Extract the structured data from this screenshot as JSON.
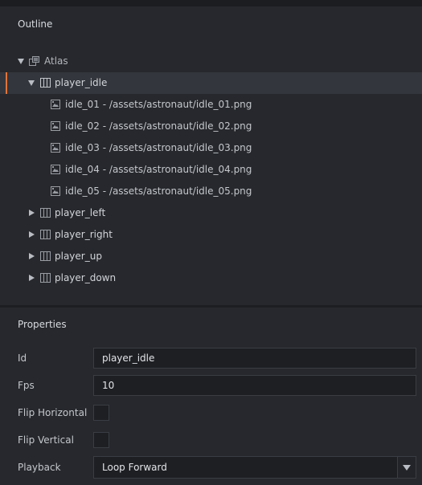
{
  "outline": {
    "title": "Outline",
    "root": {
      "label": "Atlas",
      "icon": "atlas-icon",
      "expanded": true
    },
    "animations": [
      {
        "label": "player_idle",
        "icon": "animation-icon",
        "expanded": true,
        "selected": true,
        "images": [
          {
            "label": "idle_01 - /assets/astronaut/idle_01.png",
            "icon": "image-icon"
          },
          {
            "label": "idle_02 - /assets/astronaut/idle_02.png",
            "icon": "image-icon"
          },
          {
            "label": "idle_03 - /assets/astronaut/idle_03.png",
            "icon": "image-icon"
          },
          {
            "label": "idle_04 - /assets/astronaut/idle_04.png",
            "icon": "image-icon"
          },
          {
            "label": "idle_05 - /assets/astronaut/idle_05.png",
            "icon": "image-icon"
          }
        ]
      },
      {
        "label": "player_left",
        "icon": "animation-icon",
        "expanded": false
      },
      {
        "label": "player_right",
        "icon": "animation-icon",
        "expanded": false
      },
      {
        "label": "player_up",
        "icon": "animation-icon",
        "expanded": false
      },
      {
        "label": "player_down",
        "icon": "animation-icon",
        "expanded": false
      }
    ]
  },
  "properties": {
    "title": "Properties",
    "id": {
      "label": "Id",
      "value": "player_idle"
    },
    "fps": {
      "label": "Fps",
      "value": "10"
    },
    "flip_horizontal": {
      "label": "Flip Horizontal",
      "checked": false
    },
    "flip_vertical": {
      "label": "Flip Vertical",
      "checked": false
    },
    "playback": {
      "label": "Playback",
      "value": "Loop Forward"
    }
  },
  "colors": {
    "accent": "#e2743a",
    "panel": "#26282d",
    "field": "#1d1f23"
  }
}
